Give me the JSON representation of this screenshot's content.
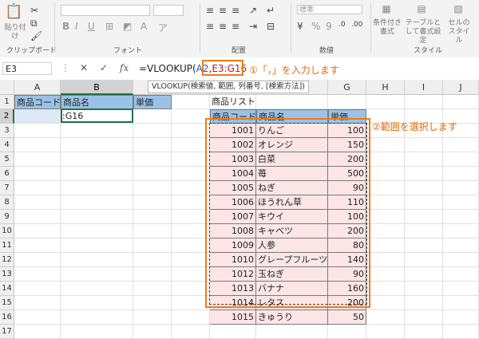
{
  "ribbon": {
    "clipboard": {
      "paste_label": "貼り付け",
      "group_label": "クリップボード"
    },
    "font": {
      "group_label": "フォント",
      "bold": "B",
      "italic": "I",
      "underline": "U"
    },
    "alignment": {
      "group_label": "配置"
    },
    "number": {
      "format_value": "標準",
      "percent": "%",
      "comma": "9",
      "group_label": "数値"
    },
    "styles": {
      "group_label": "スタイル",
      "conditional": "条件付き書式",
      "table": "テーブルとして書式設定",
      "cell": "セルのスタイル"
    }
  },
  "formula_bar": {
    "namebox": "E3",
    "cancel": "✕",
    "enter": "✓",
    "fx": "fx",
    "formula_prefix": "=VLOOKUP(",
    "formula_arg1": "A2",
    "formula_comma": ",",
    "formula_range": "E3:G16"
  },
  "annotation1": "①「，」を入力します",
  "tooltip": "VLOOKUP(検索値, 範囲, 列番号, [検索方法])",
  "annotation2": "②範囲を選択します",
  "columns": [
    "A",
    "B",
    "C",
    "D",
    "E",
    "F",
    "G",
    "H",
    "I",
    "J"
  ],
  "rows": [
    "1",
    "2",
    "3",
    "4",
    "5",
    "6",
    "7",
    "8",
    "9",
    "10",
    "11",
    "12",
    "13",
    "14",
    "15",
    "16",
    "17"
  ],
  "left_table": {
    "headers": [
      "商品コード",
      "商品名",
      "単価"
    ],
    "b2_text": ":G16"
  },
  "product_list": {
    "title": "商品リスト",
    "headers": [
      "商品コード",
      "商品名",
      "単価"
    ],
    "rows": [
      {
        "code": "1001",
        "name": "りんご",
        "price": "100"
      },
      {
        "code": "1002",
        "name": "オレンジ",
        "price": "150"
      },
      {
        "code": "1003",
        "name": "白菜",
        "price": "200"
      },
      {
        "code": "1004",
        "name": "苺",
        "price": "500"
      },
      {
        "code": "1005",
        "name": "ねぎ",
        "price": "90"
      },
      {
        "code": "1006",
        "name": "ほうれん草",
        "price": "110"
      },
      {
        "code": "1007",
        "name": "キウイ",
        "price": "100"
      },
      {
        "code": "1008",
        "name": "キャベツ",
        "price": "200"
      },
      {
        "code": "1009",
        "name": "人参",
        "price": "80"
      },
      {
        "code": "1010",
        "name": "グレープフルーツ",
        "price": "140"
      },
      {
        "code": "1012",
        "name": "玉ねぎ",
        "price": "90"
      },
      {
        "code": "1013",
        "name": "バナナ",
        "price": "160"
      },
      {
        "code": "1014",
        "name": "レタス",
        "price": "200"
      },
      {
        "code": "1015",
        "name": "きゅうり",
        "price": "50"
      }
    ]
  }
}
